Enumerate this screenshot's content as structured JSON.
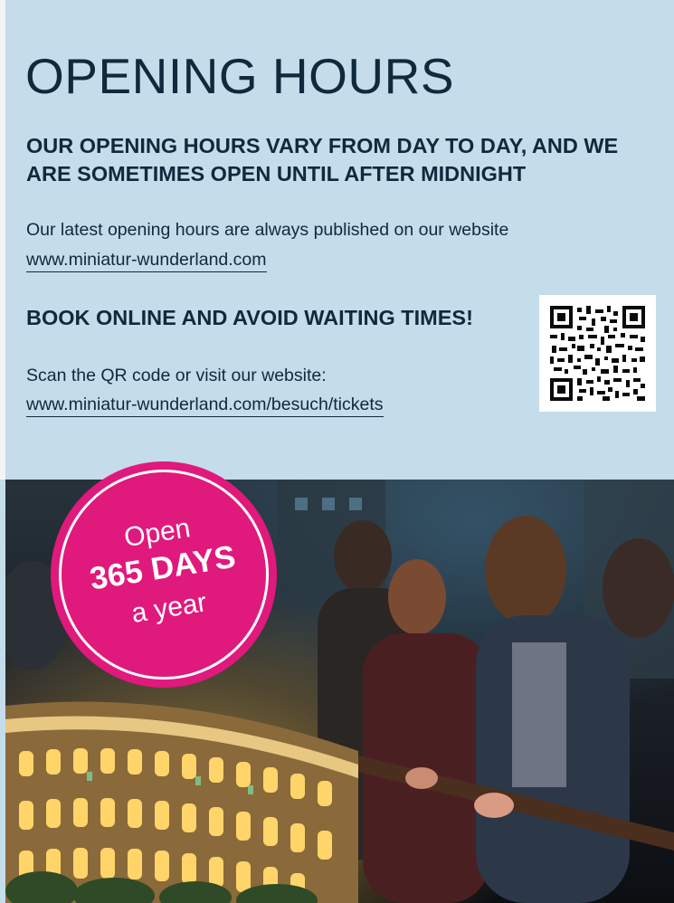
{
  "page": {
    "title": "OPENING HOURS"
  },
  "hours": {
    "heading": "OUR OPENING HOURS VARY FROM DAY TO DAY, AND WE ARE SOMETIMES OPEN UNTIL AFTER MIDNIGHT",
    "text": "Our latest opening hours are always published on our website",
    "link": "www.miniatur-wunderland.com"
  },
  "booking": {
    "heading": "BOOK ONLINE AND AVOID WAITING TIMES!",
    "text": "Scan the QR code or visit our website:",
    "link": "www.miniatur-wunderland.com/besuch/tickets"
  },
  "badge": {
    "line1": "Open",
    "line2": "365 DAYS",
    "line3": "a year"
  },
  "colors": {
    "background": "#c5dcea",
    "text": "#0e2a3c",
    "badge": "#e0197d"
  },
  "icons": {
    "qr": "qr-code",
    "photo": "colosseum-model-photo"
  }
}
